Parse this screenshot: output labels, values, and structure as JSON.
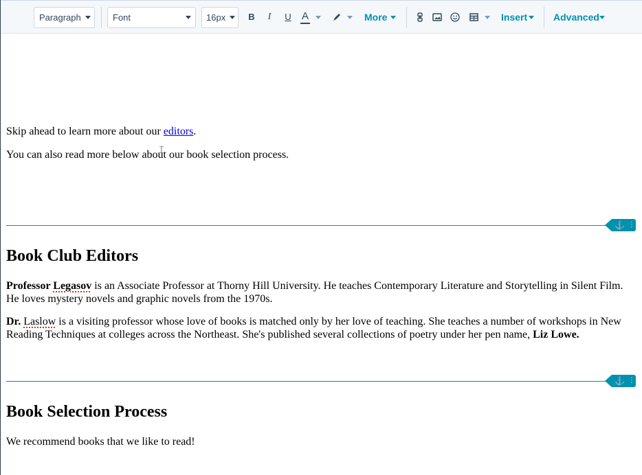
{
  "toolbar": {
    "paragraph_select": "Paragraph",
    "font_select": "Font",
    "size_select": "16px",
    "bold": "B",
    "italic": "I",
    "underline": "U",
    "text_color": "A",
    "more_label": "More",
    "insert_label": "Insert",
    "advanced_label": "Advanced"
  },
  "content": {
    "skip_prefix": "Skip ahead to learn more about our ",
    "skip_link": "editors",
    "skip_suffix": ".",
    "also_read": "You can also read more below about our book selection process.",
    "editors_heading": "Book Club Editors",
    "prof_title": "Professor ",
    "prof_name": "Legasov",
    "prof_text": " is an Associate Professor at Thorny Hill University. He teaches Contemporary Literature and Storytelling in Silent Film. He loves mystery novels and graphic novels from the 1970s.",
    "dr_title": "Dr. ",
    "dr_name": "Laslow",
    "dr_text": " is a visiting professor whose love of books is matched only by her love of teaching. She teaches a number of workshops in New Reading Techniques at colleges across the Northeast. She's published several collections of poetry under her pen name, ",
    "pen_name": "Liz Lowe.",
    "selection_heading": "Book Selection Process",
    "recommend": "We recommend books that we like to read!"
  },
  "colors": {
    "accent": "#0091ae",
    "toolbar_bg": "#f5f8fa",
    "link": "#0000ee"
  },
  "icons": [
    "highlight-pen-icon",
    "link-icon",
    "image-icon",
    "emoji-icon",
    "table-icon",
    "anchor-icon",
    "drag-handle-icon",
    "text-cursor-icon"
  ]
}
